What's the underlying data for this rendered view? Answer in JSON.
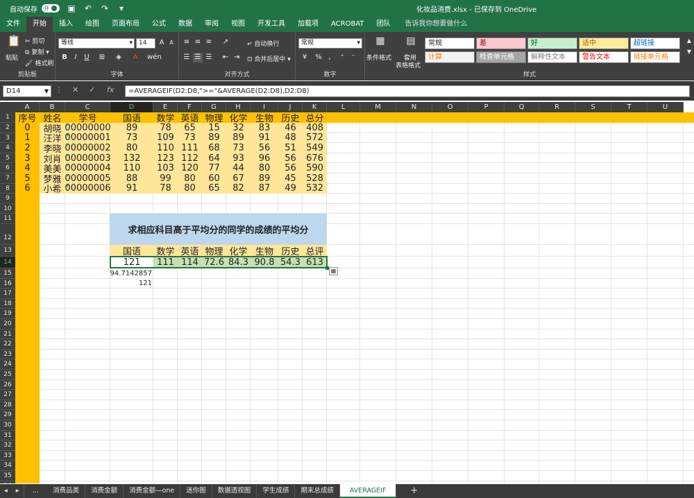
{
  "window": {
    "autosave_label": "自动保存",
    "autosave_state": "开",
    "document_title": "化妆品消费.xlsx - 已保存到 OneDrive"
  },
  "ribbon_tabs": [
    {
      "label": "文件"
    },
    {
      "label": "开始",
      "active": true
    },
    {
      "label": "插入"
    },
    {
      "label": "绘图"
    },
    {
      "label": "页面布局"
    },
    {
      "label": "公式"
    },
    {
      "label": "数据"
    },
    {
      "label": "审阅"
    },
    {
      "label": "视图"
    },
    {
      "label": "开发工具"
    },
    {
      "label": "加载项"
    },
    {
      "label": "ACROBAT"
    },
    {
      "label": "团队"
    }
  ],
  "tell_me": "告诉我你想要做什么",
  "ribbon": {
    "clipboard": {
      "paste": "粘贴",
      "cut": "剪切",
      "copy": "复制",
      "format_painter": "格式刷",
      "group": "剪贴板"
    },
    "font": {
      "name": "等线",
      "size": "14",
      "grow": "A",
      "shrink": "A",
      "bold": "B",
      "italic": "I",
      "underline": "U",
      "group": "字体"
    },
    "alignment": {
      "wrap": "自动换行",
      "merge": "合并后居中",
      "group": "对齐方式"
    },
    "number": {
      "format": "常规",
      "pct": "%",
      "comma": ",",
      "group": "数字"
    },
    "styles_group": {
      "conditional": "条件格式",
      "table": "套用",
      "table2": "表格格式",
      "group": "样式"
    },
    "styles": [
      {
        "label": "常规",
        "bg": "#ffffff",
        "fg": "#222222"
      },
      {
        "label": "差",
        "bg": "#ffc7ce",
        "fg": "#9c0006"
      },
      {
        "label": "好",
        "bg": "#c6efce",
        "fg": "#006100"
      },
      {
        "label": "适中",
        "bg": "#ffeb9c",
        "fg": "#9c6500"
      },
      {
        "label": "超链接",
        "bg": "#ffffff",
        "fg": "#0563c1"
      },
      {
        "label": "计算",
        "bg": "#f2f2f2",
        "fg": "#fa7d00"
      },
      {
        "label": "检查单元格",
        "bg": "#a5a5a5",
        "fg": "#ffffff"
      },
      {
        "label": "解释性文本",
        "bg": "#ffffff",
        "fg": "#7f7f7f"
      },
      {
        "label": "警告文本",
        "bg": "#ffffff",
        "fg": "#ff0000"
      },
      {
        "label": "链接单元格",
        "bg": "#ffffff",
        "fg": "#fa7d00"
      }
    ]
  },
  "formula_bar": {
    "name_box": "D14",
    "fx": "fx",
    "formula": "=AVERAGEIF(D2:D8,\">=\"&AVERAGE(D2:D8),D2:D8)"
  },
  "columns": [
    "A",
    "B",
    "C",
    "D",
    "E",
    "F",
    "G",
    "H",
    "I",
    "J",
    "K",
    "L",
    "M",
    "N",
    "O",
    "P",
    "Q",
    "R",
    "S",
    "T",
    "U"
  ],
  "selected_column": "D",
  "row_count": 37,
  "selected_row": 14,
  "header_row": [
    "序号",
    "姓名",
    "学号",
    "国语",
    "数学",
    "英语",
    "物理",
    "化学",
    "生物",
    "历史",
    "总分"
  ],
  "students": [
    [
      "0",
      "胡晓",
      "00000000",
      "89",
      "78",
      "65",
      "15",
      "32",
      "83",
      "46",
      "408"
    ],
    [
      "1",
      "汪洋",
      "00000001",
      "73",
      "109",
      "73",
      "89",
      "89",
      "91",
      "48",
      "572"
    ],
    [
      "2",
      "李晓",
      "00000002",
      "80",
      "110",
      "111",
      "68",
      "73",
      "56",
      "51",
      "549"
    ],
    [
      "3",
      "刘肖",
      "00000003",
      "132",
      "123",
      "112",
      "64",
      "93",
      "96",
      "56",
      "676"
    ],
    [
      "4",
      "美美",
      "00000004",
      "110",
      "103",
      "120",
      "77",
      "44",
      "80",
      "56",
      "590"
    ],
    [
      "5",
      "梦雅",
      "00000005",
      "88",
      "99",
      "80",
      "60",
      "67",
      "89",
      "45",
      "528"
    ],
    [
      "6",
      "小希",
      "00000006",
      "91",
      "78",
      "80",
      "65",
      "82",
      "87",
      "49",
      "532"
    ]
  ],
  "summary": {
    "title": "求相应科目高于平均分的同学的成绩的平均分",
    "headers": [
      "国语",
      "数学",
      "英语",
      "物理",
      "化学",
      "生物",
      "历史",
      "总评"
    ],
    "values": [
      "121",
      "111",
      "114",
      "72.6",
      "84.3",
      "90.8",
      "54.3",
      "613"
    ]
  },
  "notes": [
    "94.7142857",
    "121"
  ],
  "sheet_tabs": [
    "消费品类",
    "消费金额",
    "消费金额—one",
    "迷你图",
    "数据透视图",
    "学生成绩",
    "期末总成绩",
    "AVERAGEIF"
  ],
  "active_sheet": "AVERAGEIF",
  "add_sheet": "+",
  "colors": {
    "accent": "#217346",
    "orange": "#ffc000",
    "light_orange": "#ffe699",
    "light_blue": "#bdd7ee",
    "sel_green": "#c6e0b4"
  }
}
